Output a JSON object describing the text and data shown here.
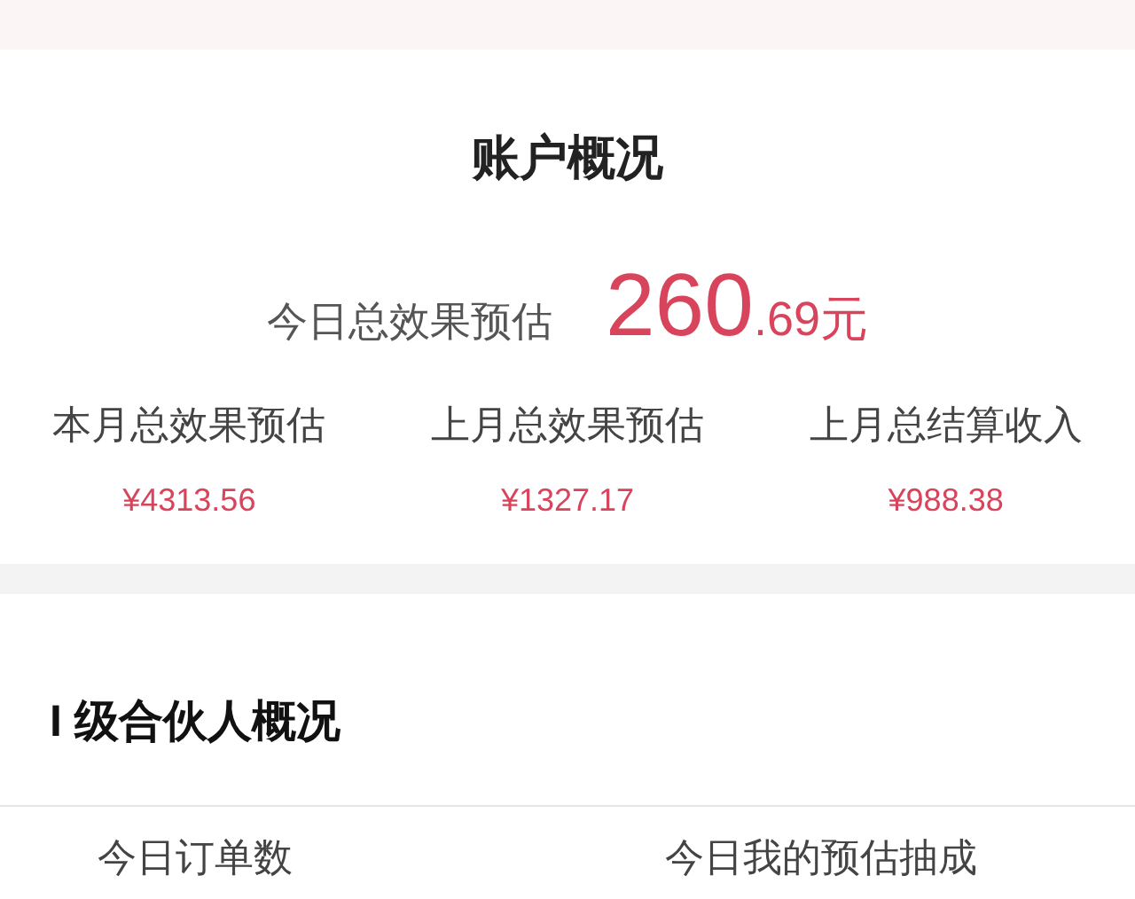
{
  "account_overview": {
    "title": "账户概况",
    "today": {
      "label": "今日总效果预估",
      "amount_main": "260",
      "amount_sub": ".69元"
    },
    "stats": [
      {
        "label": "本月总效果预估",
        "value": "¥4313.56"
      },
      {
        "label": "上月总效果预估",
        "value": "¥1327.17"
      },
      {
        "label": "上月总结算收入",
        "value": "¥988.38"
      }
    ]
  },
  "partner_overview": {
    "title": "I 级合伙人概况",
    "stats": [
      {
        "label": "今日订单数"
      },
      {
        "label": "今日我的预估抽成"
      }
    ]
  }
}
